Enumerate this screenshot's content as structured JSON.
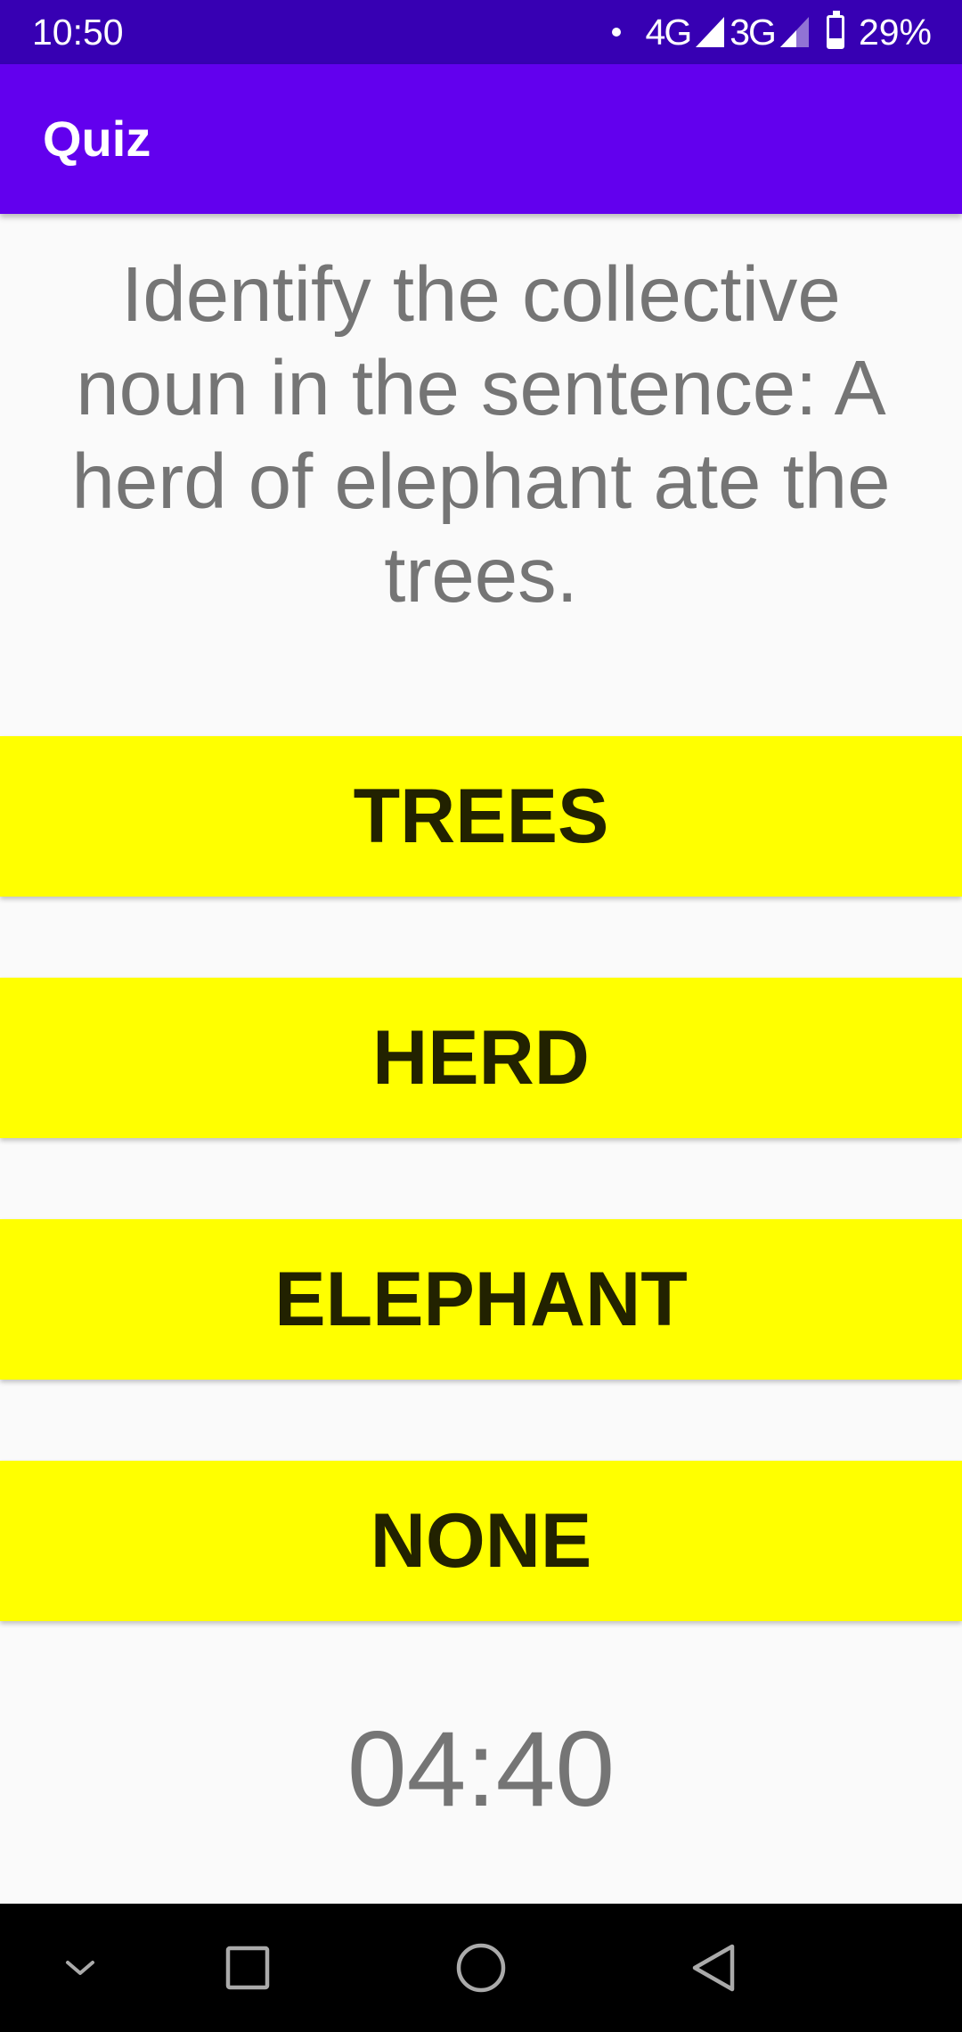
{
  "status_bar": {
    "time": "10:50",
    "network_1": "4G",
    "network_2": "3G",
    "battery_percent": "29%",
    "battery_level": 0.29
  },
  "app_bar": {
    "title": "Quiz"
  },
  "question": {
    "text": "Identify the collective noun in the sentence: A herd of elephant ate the trees."
  },
  "answers": [
    {
      "label": "TREES"
    },
    {
      "label": "HERD"
    },
    {
      "label": "ELEPHANT"
    },
    {
      "label": "NONE"
    }
  ],
  "timer": {
    "value": "04:40"
  },
  "colors": {
    "status_bar": "#3700b3",
    "app_bar": "#6200ee",
    "answer_background": "#ffff00",
    "question_text": "#757575"
  },
  "nav_bar": {
    "icons": [
      "chevron-down-icon",
      "recents-square-icon",
      "home-circle-icon",
      "back-triangle-icon"
    ]
  }
}
